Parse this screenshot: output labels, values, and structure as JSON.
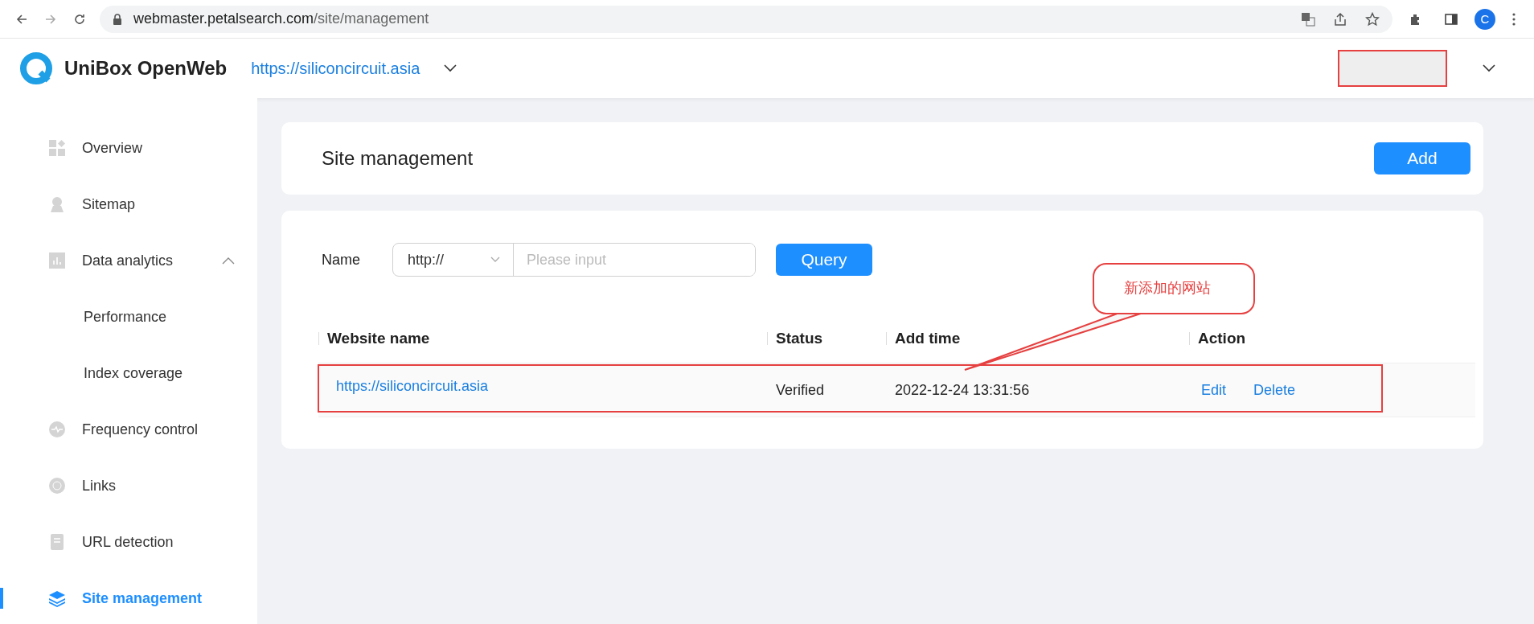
{
  "browser": {
    "url_host": "webmaster.petalsearch.com",
    "url_path": "/site/management",
    "profile": "C"
  },
  "header": {
    "brand": "UniBox OpenWeb",
    "site": "https://siliconcircuit.asia"
  },
  "sidebar": {
    "items": [
      {
        "label": "Overview",
        "selected": false
      },
      {
        "label": "Sitemap",
        "selected": false
      },
      {
        "label": "Data analytics",
        "selected": false,
        "expanded": true,
        "children": [
          {
            "label": "Performance",
            "selected": false
          },
          {
            "label": "Index coverage",
            "selected": false
          }
        ]
      },
      {
        "label": "Frequency control",
        "selected": false
      },
      {
        "label": "Links",
        "selected": false
      },
      {
        "label": "URL detection",
        "selected": false
      },
      {
        "label": "Site management",
        "selected": true
      }
    ]
  },
  "page": {
    "title": "Site management",
    "add_button": "Add"
  },
  "filter": {
    "label": "Name",
    "protocol": "http://",
    "placeholder": "Please input",
    "query_button": "Query"
  },
  "table": {
    "columns": [
      "Website name",
      "Status",
      "Add time",
      "Action"
    ],
    "rows": [
      {
        "website": "https://siliconcircuit.asia",
        "status": "Verified",
        "add_time": "2022-12-24 13:31:56",
        "actions": [
          "Edit",
          "Delete"
        ]
      }
    ]
  },
  "annotation": {
    "text": "新添加的网站"
  }
}
